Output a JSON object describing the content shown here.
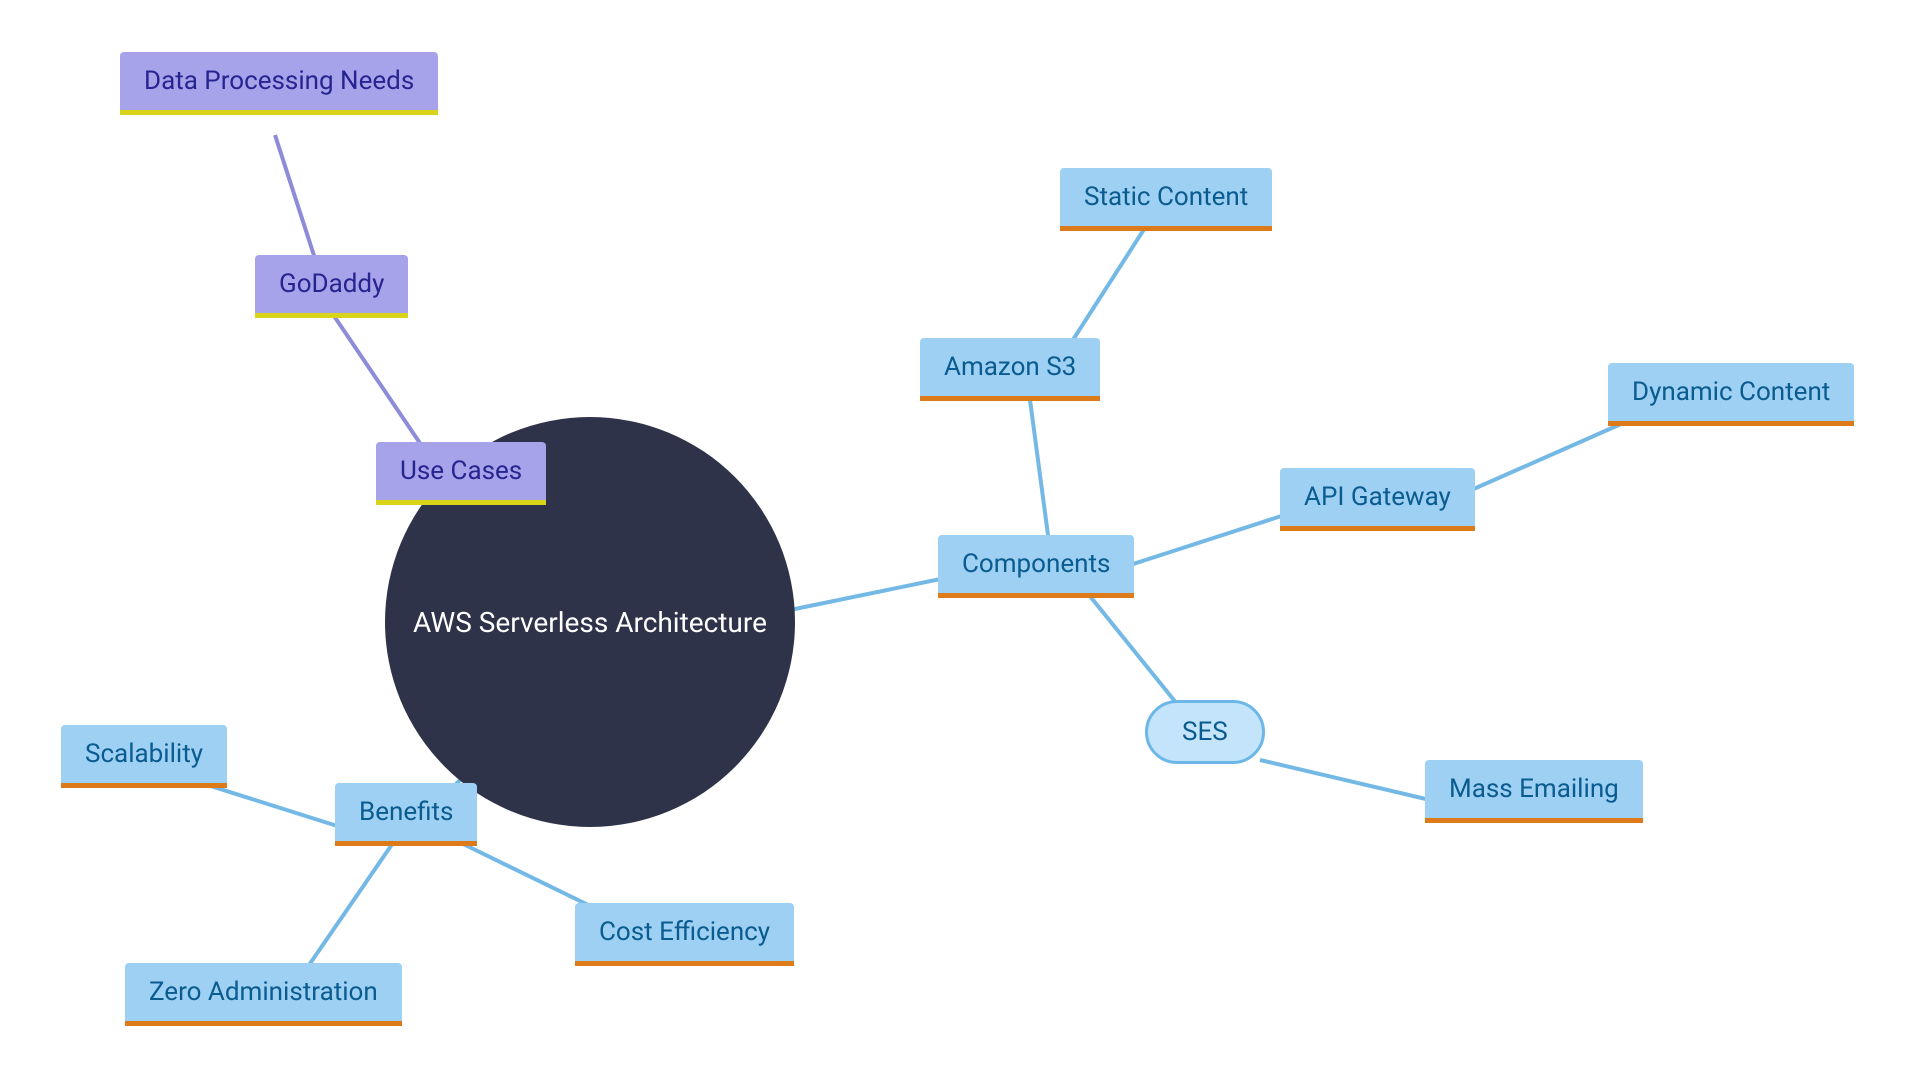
{
  "center": {
    "label": "AWS Serverless Architecture"
  },
  "useCases": {
    "label": "Use Cases",
    "children": {
      "goDaddy": {
        "label": "GoDaddy",
        "children": {
          "dataProcessing": {
            "label": "Data Processing Needs"
          }
        }
      }
    }
  },
  "benefits": {
    "label": "Benefits",
    "children": {
      "scalability": {
        "label": "Scalability"
      },
      "zeroAdmin": {
        "label": "Zero Administration"
      },
      "costEfficiency": {
        "label": "Cost Efficiency"
      }
    }
  },
  "components": {
    "label": "Components",
    "children": {
      "amazonS3": {
        "label": "Amazon S3",
        "children": {
          "staticContent": {
            "label": "Static Content"
          }
        }
      },
      "apiGateway": {
        "label": "API Gateway",
        "children": {
          "dynamicContent": {
            "label": "Dynamic Content"
          }
        }
      },
      "ses": {
        "label": "SES",
        "children": {
          "massEmailing": {
            "label": "Mass Emailing"
          }
        }
      }
    }
  },
  "colors": {
    "centerBg": "#2f3349",
    "blueBg": "#9dd0f2",
    "blueText": "#0a5b8f",
    "blueUnderline": "#dd7b1a",
    "purpleBg": "#a7a3ea",
    "purpleText": "#26248f",
    "purpleUnderline": "#d9d41a",
    "edgeBlue": "#74b9e6",
    "edgePurple": "#8e8cd9"
  }
}
